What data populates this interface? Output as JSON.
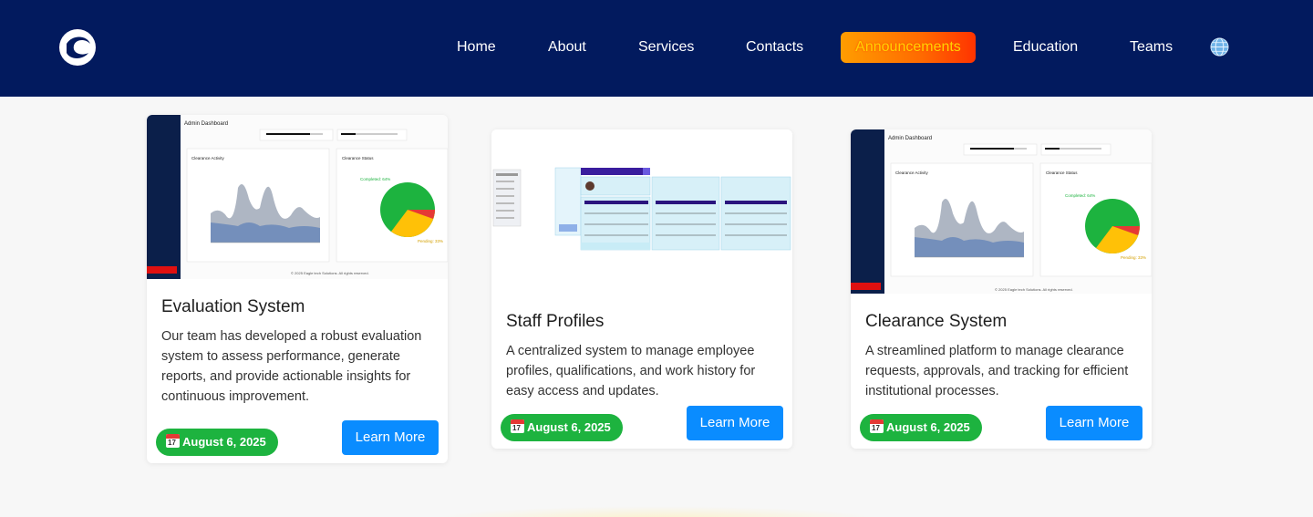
{
  "nav": {
    "items": [
      {
        "label": "Home"
      },
      {
        "label": "About"
      },
      {
        "label": "Services"
      },
      {
        "label": "Contacts"
      },
      {
        "label": "Announcements",
        "active": true
      },
      {
        "label": "Education"
      },
      {
        "label": "Teams"
      }
    ],
    "language_icon": "globe-icon"
  },
  "cards": [
    {
      "title": "Evaluation System",
      "description": "Our team has developed a robust evaluation system to assess performance, generate reports, and provide actionable insights for continuous improvement.",
      "date": "August 6, 2025",
      "button": "Learn More",
      "thumbnail": {
        "header": "Admin Dashboard",
        "left_title": "Clearance Activity",
        "right_title": "Clearance Status",
        "completed": "Completed: 64%",
        "pending": "Pending: 33%",
        "footer": "© 2025 Eagle tech Solutions. All rights reserved."
      }
    },
    {
      "title": "Staff Profiles",
      "description": "A centralized system to manage employee profiles, qualifications, and work history for easy access and updates.",
      "date": "August 6, 2025",
      "button": "Learn More"
    },
    {
      "title": "Clearance System",
      "description": "A streamlined platform to manage clearance requests, approvals, and tracking for efficient institutional processes.",
      "date": "August 6, 2025",
      "button": "Learn More",
      "thumbnail": {
        "header": "Admin Dashboard",
        "left_title": "Clearance Activity",
        "right_title": "Clearance Status",
        "completed": "Completed: 64%",
        "pending": "Pending: 33%",
        "footer": "© 2025 Eagle tech Solutions. All rights reserved."
      }
    }
  ],
  "colors": {
    "header_bg": "#021a5e",
    "active_nav": "#ff7a00",
    "badge_bg": "#1db33f",
    "button_bg": "#0a8cff"
  }
}
